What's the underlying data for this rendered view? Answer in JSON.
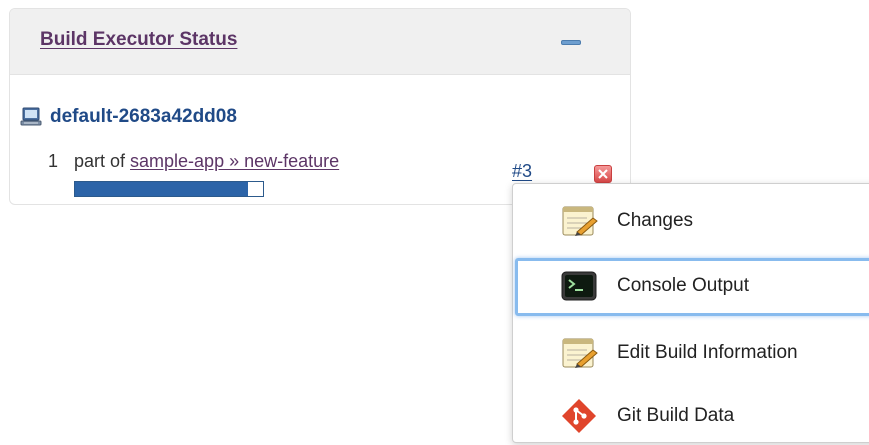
{
  "panel": {
    "title": "Build Executor Status",
    "collapse_icon": "minus-icon"
  },
  "computer": {
    "icon": "computer-icon",
    "name": "default-2683a42dd08"
  },
  "executor": {
    "number": "1",
    "prefix": "part of ",
    "job_link": "sample-app » new-feature",
    "progress_percent": 92,
    "build_link": "#3",
    "stop_icon": "stop-icon"
  },
  "menu": {
    "items": [
      {
        "label": "Changes",
        "icon": "notepad-icon"
      },
      {
        "label": "Console Output",
        "icon": "terminal-icon"
      },
      {
        "label": "Edit Build Information",
        "icon": "notepad-icon"
      },
      {
        "label": "Git Build Data",
        "icon": "git-icon"
      }
    ]
  },
  "colors": {
    "title_link": "#5c3566",
    "computer_link": "#204a87",
    "progress_fill": "#2c64a8",
    "menu_highlight": "#88bbee",
    "stop_red": "#d94848"
  }
}
